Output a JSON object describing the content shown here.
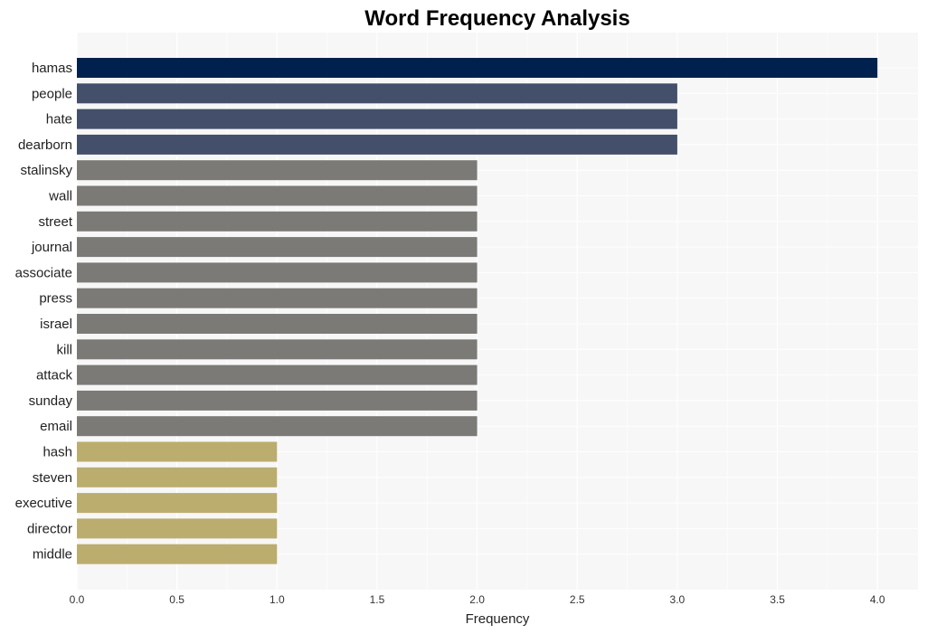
{
  "chart_data": {
    "type": "bar",
    "orientation": "horizontal",
    "title": "Word Frequency Analysis",
    "xlabel": "Frequency",
    "ylabel": "",
    "xlim": [
      0,
      4.2
    ],
    "xticks": [
      "0.0",
      "0.5",
      "1.0",
      "1.5",
      "2.0",
      "2.5",
      "3.0",
      "3.5",
      "4.0"
    ],
    "grid": true,
    "legend": "none",
    "categories": [
      "hamas",
      "people",
      "hate",
      "dearborn",
      "stalinsky",
      "wall",
      "street",
      "journal",
      "associate",
      "press",
      "israel",
      "kill",
      "attack",
      "sunday",
      "email",
      "hash",
      "steven",
      "executive",
      "director",
      "middle"
    ],
    "values": [
      4,
      3,
      3,
      3,
      2,
      2,
      2,
      2,
      2,
      2,
      2,
      2,
      2,
      2,
      2,
      1,
      1,
      1,
      1,
      1
    ],
    "colors": {
      "4": "#00214d",
      "3": "#434f6b",
      "2": "#7b7a76",
      "1": "#bbad6e",
      "panel_background": "#f7f7f7",
      "gridline": "#ffffff"
    }
  }
}
